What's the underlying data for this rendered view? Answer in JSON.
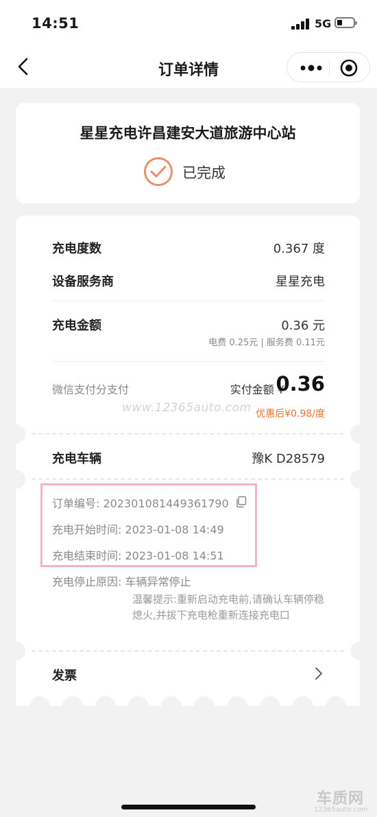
{
  "status_bar": {
    "time": "14:51",
    "network": "5G"
  },
  "nav": {
    "title": "订单详情",
    "back_icon": "chevron-left-icon",
    "more_icon": "more-dots-icon",
    "close_icon": "target-circle-icon"
  },
  "summary": {
    "station": "星星充电许昌建安大道旅游中心站",
    "status": "已完成",
    "status_icon": "check-circle-icon",
    "accent": "#e8906a"
  },
  "details": {
    "kwh_label": "充电度数",
    "kwh_value": "0.367 度",
    "provider_label": "设备服务商",
    "provider_value": "星星充电",
    "amount_label": "充电金额",
    "amount_value": "0.36 元",
    "amount_breakdown": "电费 0.25元 | 服务费 0.11元",
    "pay_method": "微信支付分支付",
    "paid_label": "实付金额 ¥",
    "paid_amount": "0.36",
    "discount": "优惠后¥0.98/度",
    "watermark": "www.12365auto.com"
  },
  "vehicle": {
    "label": "充电车辆",
    "plate": "豫K D28579"
  },
  "order": {
    "id_label": "订单编号:",
    "id_value": "202301081449361790",
    "start_label": "充电开始时间:",
    "start_value": "2023-01-08 14:49",
    "end_label": "充电结束时间:",
    "end_value": "2023-01-08 14:51",
    "stop_label": "充电停止原因:",
    "stop_value": "车辆异常停止",
    "tip": "温馨提示:重新启动充电前,请确认车辆停稳熄火,并拔下充电枪重新连接充电口",
    "highlight_color": "#f2b2cf"
  },
  "invoice": {
    "label": "发票",
    "chevron_icon": "chevron-right-icon"
  },
  "branding": {
    "logo_text": "车质网",
    "url_text": "12365auto.com"
  }
}
